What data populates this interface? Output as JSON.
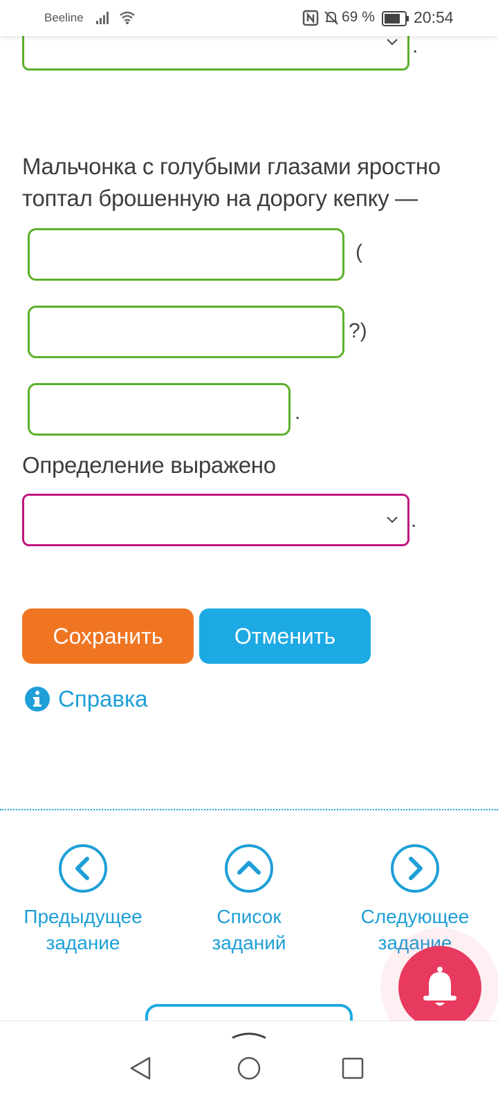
{
  "status_bar": {
    "carrier": "Beeline",
    "battery": "69 %",
    "time": "20:54"
  },
  "question": {
    "sentence": "Мальчонка с голубыми глазами яростно топтал брошенную на дорогу кепку —",
    "after_field_1": "(",
    "after_field_2": "?)",
    "after_field_3": ".",
    "after_top_select": ".",
    "definition_label": "Определение выражено",
    "after_definition_select": "."
  },
  "buttons": {
    "save": "Сохранить",
    "cancel": "Отменить"
  },
  "help": {
    "label": "Справка",
    "icon": "info-icon"
  },
  "task_nav": {
    "prev": [
      "Предыдущее",
      "задание"
    ],
    "list": [
      "Список",
      "заданий"
    ],
    "next": [
      "Следующее",
      "задание"
    ]
  },
  "colors": {
    "green_border": "#5bb02a",
    "magenta_border": "#c0157f",
    "save": "#f07522",
    "cancel": "#1ca9e4",
    "link": "#1e9fd7",
    "bell": "#e8395f"
  }
}
